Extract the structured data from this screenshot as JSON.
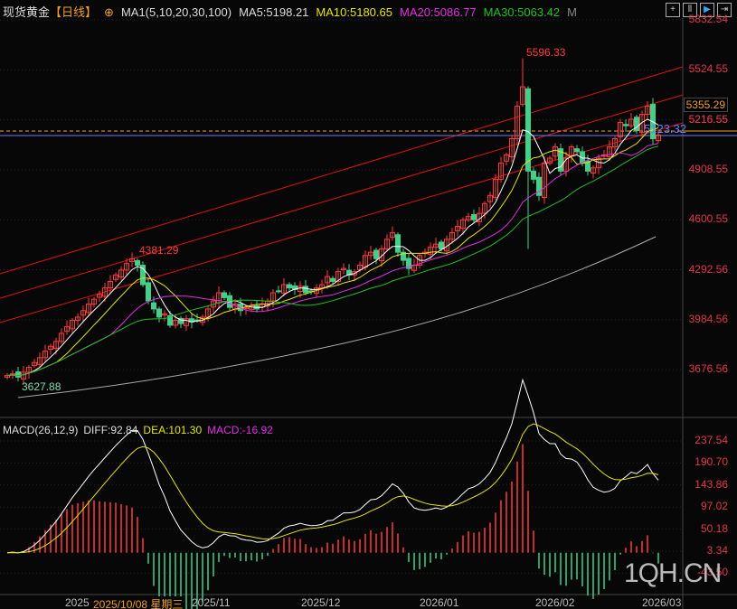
{
  "header": {
    "title": "现货黄金",
    "period": "【日线】",
    "ma_label": "MA1(5,10,20,30,100)",
    "ma5": "MA5:5198.21",
    "ma10": "MA10:5180.65",
    "ma20": "MA20:5086.77",
    "ma30": "MA30:5063.42",
    "more": "M"
  },
  "toolbar_icons": [
    "grid-icon",
    "bar-chart-icon",
    "cursor-icon",
    "expand-icon"
  ],
  "price_axis": [
    "5832.54",
    "5524.55",
    "5216.55",
    "4908.55",
    "4600.55",
    "4292.56",
    "3984.56",
    "3676.56"
  ],
  "price_tags": {
    "last": "5123.32",
    "high_mark": "5355.29",
    "ref": "5216.55"
  },
  "annotations": {
    "high": "5596.33",
    "mid_high": "4381.29",
    "low": "3627.88"
  },
  "macd": {
    "label": "MACD(26,12,9)",
    "diff": "DIFF:92.84",
    "dea": "DEA:101.30",
    "macd": "MACD:-16.92",
    "axis": [
      "237.54",
      "190.70",
      "143.86",
      "97.02",
      "50.18",
      "3.34",
      "-43.50"
    ]
  },
  "x_axis": [
    "2025",
    "2025/10/08 星期三",
    "2025/11",
    "2025/12",
    "2026/01",
    "2026/02",
    "2026/03"
  ],
  "watermark": "1QH.CN",
  "colors": {
    "up": "#ff3b3b",
    "down": "#3fd08a",
    "ma5": "#ffffff",
    "ma10": "#e6e600",
    "ma20": "#e030e0",
    "ma30": "#20c020",
    "axis": "#e0384b"
  },
  "chart_data": {
    "type": "candlestick",
    "y_range": [
      3676.56,
      5832.54
    ],
    "closes": [
      3640,
      3650,
      3630,
      3660,
      3690,
      3720,
      3750,
      3790,
      3820,
      3850,
      3900,
      3940,
      3980,
      4000,
      4040,
      4080,
      4110,
      4140,
      4180,
      4220,
      4260,
      4290,
      4330,
      4360,
      4320,
      4200,
      4100,
      4050,
      4000,
      4020,
      3950,
      3980,
      3960,
      3990,
      3970,
      3980,
      4000,
      4050,
      4100,
      4150,
      4120,
      4060,
      4080,
      4040,
      4060,
      4070,
      4050,
      4080,
      4100,
      4150,
      4160,
      4200,
      4180,
      4170,
      4190,
      4150,
      4160,
      4180,
      4200,
      4250,
      4220,
      4280,
      4300,
      4260,
      4280,
      4320,
      4380,
      4400,
      4360,
      4420,
      4480,
      4520,
      4400,
      4350,
      4300,
      4320,
      4380,
      4400,
      4430,
      4450,
      4420,
      4480,
      4520,
      4560,
      4600,
      4620,
      4600,
      4640,
      4700,
      4750,
      4850,
      4950,
      5000,
      5100,
      5300,
      5420,
      4900,
      4850,
      4750,
      4950,
      4980,
      5050,
      4900,
      4980,
      5050,
      5020,
      4950,
      4900,
      4920,
      4980,
      5000,
      5050,
      5100,
      5200,
      5180,
      5220,
      5150,
      5250,
      5300,
      5100,
      5123
    ]
  }
}
